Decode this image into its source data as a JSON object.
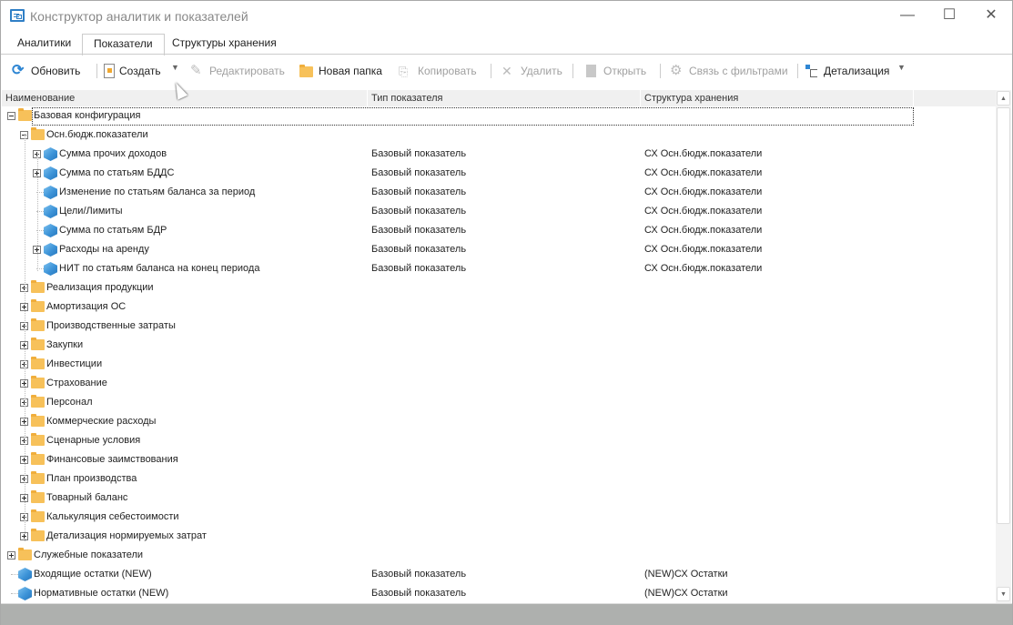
{
  "window": {
    "title": "Конструктор аналитик и показателей",
    "minimize": "—",
    "maximize": "☐",
    "close": "✕"
  },
  "tabs": [
    {
      "label": "Аналитики"
    },
    {
      "label": "Показатели",
      "active": true
    },
    {
      "label": "Структуры хранения"
    }
  ],
  "toolbar": {
    "refresh": "Обновить",
    "create": "Создать",
    "edit": "Редактировать",
    "new_folder": "Новая папка",
    "copy": "Копировать",
    "delete": "Удалить",
    "open": "Открыть",
    "filters": "Связь с фильтрами",
    "detail": "Детализация"
  },
  "columns": [
    "Наименование",
    "Тип показателя",
    "Структура хранения"
  ],
  "rows": [
    {
      "level": 0,
      "icon": "folder",
      "exp": "minus",
      "label": "Базовая конфигурация",
      "type": "",
      "struct": ""
    },
    {
      "level": 1,
      "icon": "folder",
      "exp": "minus",
      "label": "Осн.бюдж.показатели",
      "type": "",
      "struct": ""
    },
    {
      "level": 2,
      "icon": "cube",
      "exp": "plus",
      "label": "Сумма прочих доходов",
      "type": "Базовый показатель",
      "struct": "СХ Осн.бюдж.показатели"
    },
    {
      "level": 2,
      "icon": "cube",
      "exp": "plus",
      "label": "Сумма по статьям БДДС",
      "type": "Базовый показатель",
      "struct": "СХ Осн.бюдж.показатели"
    },
    {
      "level": 2,
      "icon": "cube",
      "exp": "",
      "label": "Изменение по статьям баланса за период",
      "type": "Базовый показатель",
      "struct": "СХ Осн.бюдж.показатели"
    },
    {
      "level": 2,
      "icon": "cube",
      "exp": "",
      "label": "Цели/Лимиты",
      "type": "Базовый показатель",
      "struct": "СХ Осн.бюдж.показатели"
    },
    {
      "level": 2,
      "icon": "cube",
      "exp": "",
      "label": "Сумма по статьям БДР",
      "type": "Базовый показатель",
      "struct": "СХ Осн.бюдж.показатели"
    },
    {
      "level": 2,
      "icon": "cube",
      "exp": "plus",
      "label": "Расходы на аренду",
      "type": "Базовый показатель",
      "struct": "СХ Осн.бюдж.показатели"
    },
    {
      "level": 2,
      "icon": "cube",
      "exp": "",
      "label": "НИТ по статьям баланса на конец периода",
      "type": "Базовый показатель",
      "struct": "СХ Осн.бюдж.показатели"
    },
    {
      "level": 1,
      "icon": "folder",
      "exp": "plus",
      "label": "Реализация продукции",
      "type": "",
      "struct": ""
    },
    {
      "level": 1,
      "icon": "folder",
      "exp": "plus",
      "label": "Амортизация ОС",
      "type": "",
      "struct": ""
    },
    {
      "level": 1,
      "icon": "folder",
      "exp": "plus",
      "label": "Производственные затраты",
      "type": "",
      "struct": ""
    },
    {
      "level": 1,
      "icon": "folder",
      "exp": "plus",
      "label": "Закупки",
      "type": "",
      "struct": ""
    },
    {
      "level": 1,
      "icon": "folder",
      "exp": "plus",
      "label": "Инвестиции",
      "type": "",
      "struct": ""
    },
    {
      "level": 1,
      "icon": "folder",
      "exp": "plus",
      "label": "Страхование",
      "type": "",
      "struct": ""
    },
    {
      "level": 1,
      "icon": "folder",
      "exp": "plus",
      "label": "Персонал",
      "type": "",
      "struct": ""
    },
    {
      "level": 1,
      "icon": "folder",
      "exp": "plus",
      "label": "Коммерческие расходы",
      "type": "",
      "struct": ""
    },
    {
      "level": 1,
      "icon": "folder",
      "exp": "plus",
      "label": "Сценарные условия",
      "type": "",
      "struct": ""
    },
    {
      "level": 1,
      "icon": "folder",
      "exp": "plus",
      "label": "Финансовые заимствования",
      "type": "",
      "struct": ""
    },
    {
      "level": 1,
      "icon": "folder",
      "exp": "plus",
      "label": "План производства",
      "type": "",
      "struct": ""
    },
    {
      "level": 1,
      "icon": "folder",
      "exp": "plus",
      "label": "Товарный баланс",
      "type": "",
      "struct": ""
    },
    {
      "level": 1,
      "icon": "folder",
      "exp": "plus",
      "label": "Калькуляция себестоимости",
      "type": "",
      "struct": ""
    },
    {
      "level": 1,
      "icon": "folder",
      "exp": "plus",
      "label": "Детализация нормируемых затрат",
      "type": "",
      "struct": ""
    },
    {
      "level": 0,
      "icon": "folder",
      "exp": "plus",
      "label": "Служебные показатели",
      "type": "",
      "struct": ""
    },
    {
      "level": 0,
      "icon": "cube",
      "exp": "",
      "label": "Входящие остатки (NEW)",
      "type": "Базовый показатель",
      "struct": "(NEW)СХ Остатки"
    },
    {
      "level": 0,
      "icon": "cube",
      "exp": "",
      "label": "Нормативные остатки (NEW)",
      "type": "Базовый показатель",
      "struct": "(NEW)СХ Остатки"
    }
  ]
}
